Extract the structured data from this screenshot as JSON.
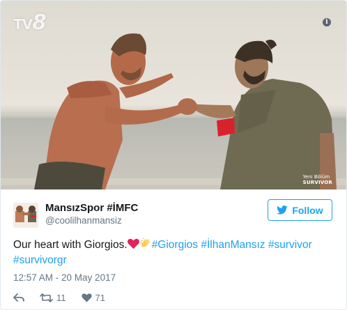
{
  "media": {
    "channel_logo_prefix": "TV",
    "channel_logo_number": "8",
    "info_icon": "info-icon",
    "watermark_line1": "Yeni Bölüm",
    "watermark_line2": "SURVIVOR"
  },
  "tweet": {
    "display_name": "MansızSpor #İMFC",
    "screen_name": "@coolilhanmansiz",
    "follow_label": "Follow",
    "text_plain": "Our heart with Giorgios.",
    "hashtags": [
      "#Giorgios",
      "#İlhanMansız",
      "#survivor",
      "#survivorgr"
    ],
    "timestamp": "12:57 AM - 20 May 2017",
    "retweets": "11",
    "likes": "71"
  },
  "colors": {
    "accent": "#1da1f2",
    "secondary_text": "#657786",
    "primary_text": "#14171a",
    "like_heart_emoji": "#e0245e"
  }
}
